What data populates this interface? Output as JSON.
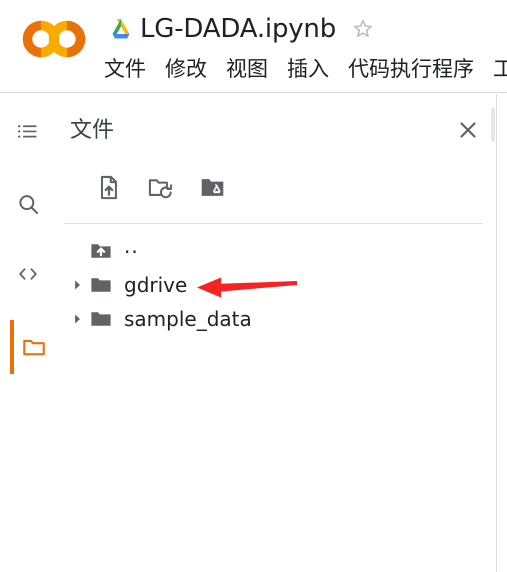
{
  "app": {
    "logo_name": "colab-logo",
    "brand_colors": {
      "orange_dark": "#E8710A",
      "orange_light": "#F9AB00"
    }
  },
  "header": {
    "drive_icon": "google-drive-icon",
    "doc_title": "LG-DADA.ipynb",
    "star_icon": "star-outline-icon",
    "menu_items": [
      {
        "label": "文件"
      },
      {
        "label": "修改"
      },
      {
        "label": "视图"
      },
      {
        "label": "插入"
      },
      {
        "label": "代码执行程序"
      },
      {
        "label": "工"
      }
    ]
  },
  "rail": {
    "items": [
      {
        "name": "table-of-contents",
        "icon": "list-icon",
        "active": false
      },
      {
        "name": "search",
        "icon": "search-icon",
        "active": false
      },
      {
        "name": "code-snippets",
        "icon": "code-brackets-icon",
        "active": false
      },
      {
        "name": "files",
        "icon": "folder-icon",
        "active": true
      }
    ],
    "active_color": "#E8710A"
  },
  "files_panel": {
    "title": "文件",
    "close_icon": "close-icon",
    "toolbar": [
      {
        "name": "upload-file",
        "icon": "upload-file-icon",
        "tooltip": "上传"
      },
      {
        "name": "refresh-folder",
        "icon": "refresh-folder-icon",
        "tooltip": "刷新"
      },
      {
        "name": "mount-drive",
        "icon": "mount-drive-icon",
        "tooltip": "装载云端硬盘"
      }
    ],
    "tree": [
      {
        "label": "..",
        "icon": "folder-up-icon",
        "has_chevron": false,
        "expanded": false
      },
      {
        "label": "gdrive",
        "icon": "folder-icon",
        "has_chevron": true,
        "expanded": false
      },
      {
        "label": "sample_data",
        "icon": "folder-icon",
        "has_chevron": true,
        "expanded": false
      }
    ]
  },
  "annotation": {
    "arrow": {
      "name": "red-pointer-arrow",
      "color": "#F72222",
      "points_to": "gdrive"
    }
  }
}
